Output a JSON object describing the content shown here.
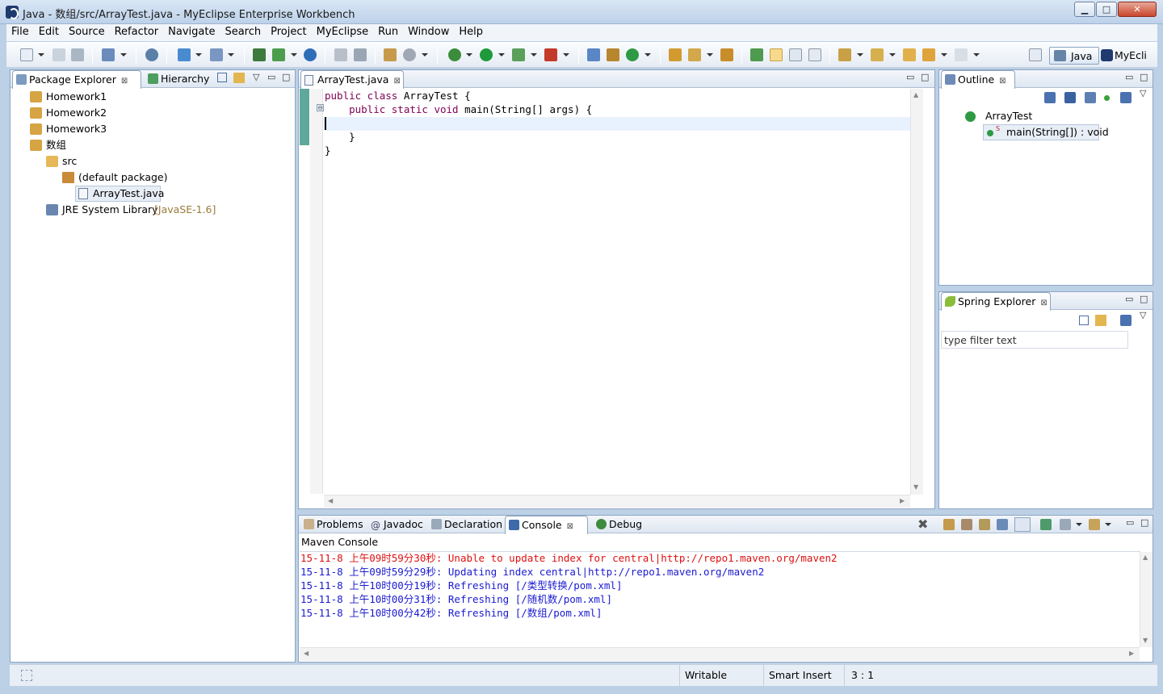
{
  "window": {
    "title": "Java - 数组/src/ArrayTest.java - MyEclipse Enterprise Workbench",
    "minimize": "▁",
    "maximize": "□",
    "close": "✕"
  },
  "menu": [
    "File",
    "Edit",
    "Source",
    "Refactor",
    "Navigate",
    "Search",
    "Project",
    "MyEclipse",
    "Run",
    "Window",
    "Help"
  ],
  "perspectives": {
    "java": "Java",
    "myeclipse": "MyEcli"
  },
  "package_explorer": {
    "tab_label": "Package Explorer",
    "hierarchy_tab": "Hierarchy",
    "tree": [
      {
        "label": "Homework1"
      },
      {
        "label": "Homework2"
      },
      {
        "label": "Homework3"
      },
      {
        "label": "数组"
      },
      {
        "label": "src"
      },
      {
        "label": "(default package)"
      },
      {
        "label": "ArrayTest.java"
      },
      {
        "label": "JRE System Library",
        "suffix": "[JavaSE-1.6]"
      }
    ]
  },
  "editor": {
    "tab_label": "ArrayTest.java",
    "lines": [
      {
        "kw": "public class",
        "rest": " ArrayTest {"
      },
      {
        "kw": "    public static void",
        "rest": " main(String[] args) {"
      },
      {
        "kw": "",
        "rest": ""
      },
      {
        "kw": "",
        "rest": "    }"
      },
      {
        "kw": "",
        "rest": "}"
      }
    ]
  },
  "outline": {
    "tab_label": "Outline",
    "class_name": "ArrayTest",
    "method": "main(String[]) : void",
    "static_marker": "S"
  },
  "spring_explorer": {
    "tab_label": "Spring Explorer",
    "filter_placeholder": "type filter text"
  },
  "bottom_tabs": {
    "problems": "Problems",
    "javadoc": "Javadoc",
    "declaration": "Declaration",
    "console": "Console",
    "debug": "Debug"
  },
  "console": {
    "title": "Maven Console",
    "lines": [
      {
        "text": "15-11-8 上午09时59分30秒: Unable to update index for central|http://repo1.maven.org/maven2",
        "color": "#e01010"
      },
      {
        "text": "15-11-8 上午09时59分29秒: Updating index central|http://repo1.maven.org/maven2",
        "color": "#1a1ad0"
      },
      {
        "text": "15-11-8 上午10时00分19秒: Refreshing [/类型转换/pom.xml]",
        "color": "#1a1ad0"
      },
      {
        "text": "15-11-8 上午10时00分31秒: Refreshing [/随机数/pom.xml]",
        "color": "#1a1ad0"
      },
      {
        "text": "15-11-8 上午10时00分42秒: Refreshing [/数组/pom.xml]",
        "color": "#1a1ad0"
      }
    ]
  },
  "status": {
    "writable": "Writable",
    "insert_mode": "Smart Insert",
    "position": "3 : 1"
  }
}
